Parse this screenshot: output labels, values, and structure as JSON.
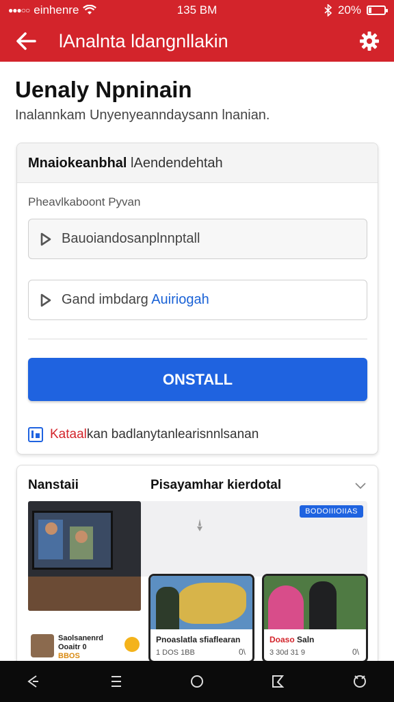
{
  "status_bar": {
    "carrier": "einhenre",
    "time": "135 BM",
    "battery": "20%",
    "battery_level": 0.2
  },
  "app_bar": {
    "title": "lAnalnta ldangnllakin"
  },
  "page": {
    "title": "Uenaly Npninain",
    "subtitle": "Inalannkam Unyenyeanndaysann lnanian."
  },
  "install_card": {
    "header_bold": "Mnaiokeanbhal",
    "header_regular": "lAendendehtah",
    "section_label": "Pheavlkaboont Pyvan",
    "option1": "Bauoiandosanplnnptall",
    "option2_prefix": "Gand  imbdarg",
    "option2_link": "Auiriogah",
    "install_button": "ONSTALL",
    "footer_red": "Kataal",
    "footer_text": "kan  badlanytanlearisnnlsanan"
  },
  "media_card": {
    "left_label": "Nanstaii",
    "title": "Pisayamhar kierdotal",
    "badge": "BODOIIIOIIAS",
    "side_item_title": "Saolsanenrd",
    "side_item_sub": "Ooaitr 0",
    "side_item_meta": "BBOS",
    "thumb1_caption": "Pnoaslatla sfiaflearan",
    "thumb1_meta": "1 DOS 1BB",
    "thumb1_duration": "0\\",
    "thumb2_caption_red": "Doaso",
    "thumb2_caption": "Saln",
    "thumb2_meta": "3 30d 31 9",
    "thumb2_duration": "0\\"
  },
  "colors": {
    "primary_red": "#d3242b",
    "primary_blue": "#1f63e0"
  },
  "icons": [
    "back-arrow-icon",
    "gear-icon",
    "play-icon",
    "calendar-icon",
    "chevron-down-icon",
    "nav-back-icon",
    "nav-menu-icon",
    "nav-home-icon",
    "nav-recent-icon",
    "nav-assistant-icon"
  ]
}
